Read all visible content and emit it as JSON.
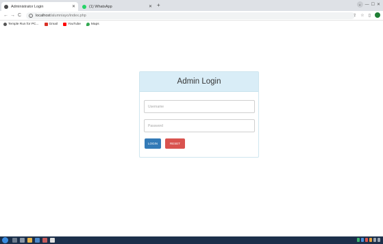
{
  "browser": {
    "tabs": [
      {
        "label": "Administrator Login",
        "favicon_color": "#4a4a4a",
        "active": true
      },
      {
        "label": "(1) WhatsApp",
        "favicon_color": "#25d366",
        "active": false
      }
    ],
    "new_tab_symbol": "+",
    "address": {
      "host": "localhost",
      "path": "/alumniayo/index.php"
    },
    "bookmarks": [
      {
        "label": "Temple Run for PC...",
        "color": "#555555"
      },
      {
        "label": "Gmail",
        "color": "#d93025"
      },
      {
        "label": "YouTube",
        "color": "#ff0000"
      },
      {
        "label": "Maps",
        "color": "#34a853"
      }
    ]
  },
  "login": {
    "title": "Admin Login",
    "username_placeholder": "Username",
    "password_placeholder": "Password",
    "login_button": "LOGIN",
    "reset_button": "RESET",
    "colors": {
      "header_bg": "#d9edf7",
      "login_btn": "#337ab7",
      "reset_btn": "#d9534f"
    }
  }
}
